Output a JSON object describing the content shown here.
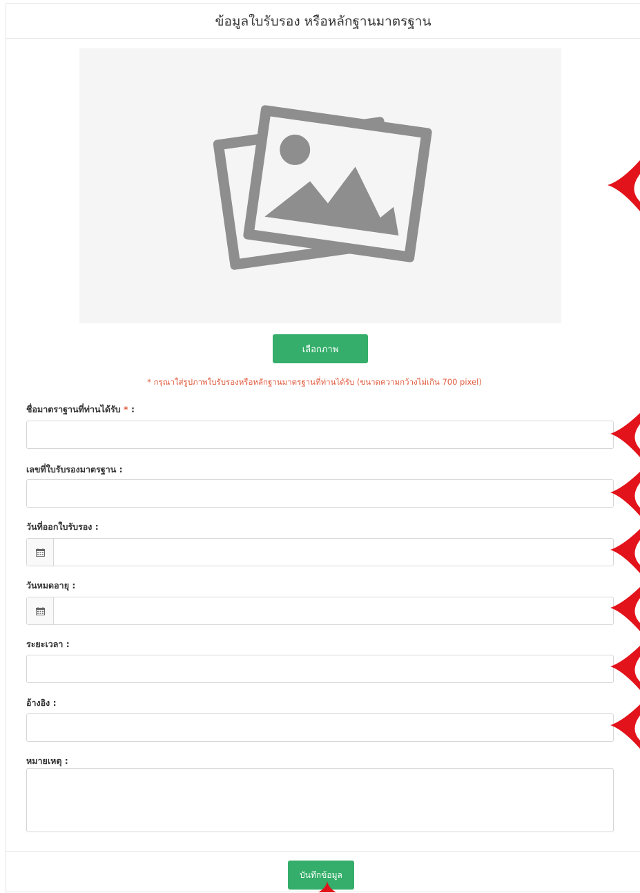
{
  "header": {
    "title": "ข้อมูลใบรับรอง หรือหลักฐานมาตรฐาน"
  },
  "image": {
    "icon": "image-placeholder-icon"
  },
  "buttons": {
    "choose_image": "เลือกภาพ",
    "save": "บันทึกข้อมูล"
  },
  "note": "* กรุณาใส่รูปภาพใบรับรองหรือหลักฐานมาตรฐานที่ท่านได้รับ (ขนาดความกว้างไม่เกิน 700 pixel)",
  "fields": {
    "standard_name": {
      "label": "ชื่อมาตราฐานที่ท่านได้รับ",
      "required_mark": "*",
      "suffix": ":",
      "value": ""
    },
    "cert_number": {
      "label": "เลขที่ใบรับรองมาตรฐาน :",
      "value": ""
    },
    "issue_date": {
      "label": "วันที่ออกใบรับรอง :",
      "value": "",
      "icon": "calendar-icon"
    },
    "expiry_date": {
      "label": "วันหมดอายุ :",
      "value": "",
      "icon": "calendar-icon"
    },
    "duration": {
      "label": "ระยะเวลา :",
      "value": ""
    },
    "reference": {
      "label": "อ้างอิง :",
      "value": ""
    },
    "remark": {
      "label": "หมายเหตุ :",
      "value": ""
    }
  },
  "colors": {
    "accent_green": "#34ae6a",
    "note_red": "#e05a3c",
    "annotation_red": "#e3131b"
  }
}
